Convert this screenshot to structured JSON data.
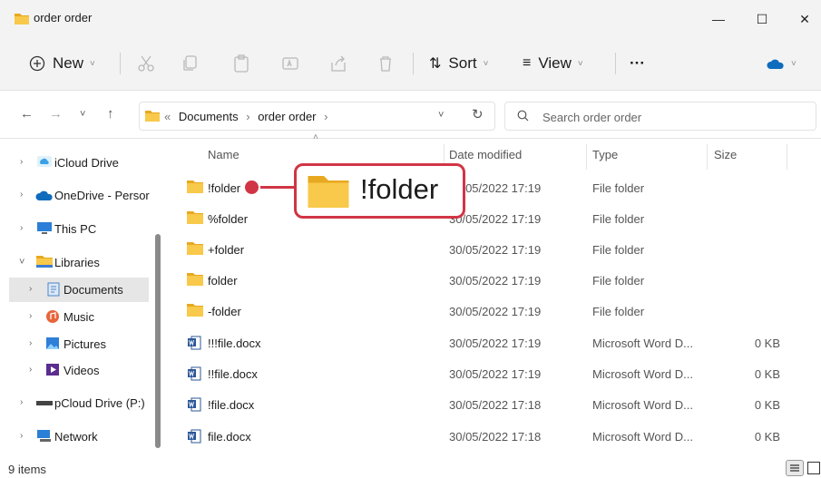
{
  "window": {
    "title": "order order",
    "minimize": "—",
    "maximize": "☐",
    "close": "✕"
  },
  "toolbar": {
    "new_label": "New",
    "sort_label": "Sort",
    "view_label": "View",
    "more_label": "···",
    "colors": {
      "accent": "#0f6cbd",
      "folder": "#f4c542",
      "word": "#2b5797"
    }
  },
  "address": {
    "overflow": "«",
    "crumbs": [
      "Documents",
      "order order"
    ],
    "separator": "›",
    "search_placeholder": "Search order order"
  },
  "sidebar": {
    "items": [
      {
        "label": "iCloud Drive",
        "icon": "icloud-icon"
      },
      {
        "label": "OneDrive - Persor",
        "icon": "onedrive-icon"
      },
      {
        "label": "This PC",
        "icon": "pc-icon"
      },
      {
        "label": "Libraries",
        "icon": "library-folder-icon"
      },
      {
        "label": "Documents",
        "icon": "documents-icon"
      },
      {
        "label": "Music",
        "icon": "music-icon"
      },
      {
        "label": "Pictures",
        "icon": "pictures-icon"
      },
      {
        "label": "Videos",
        "icon": "videos-icon"
      },
      {
        "label": "pCloud Drive (P:)",
        "icon": "drive-icon"
      },
      {
        "label": "Network",
        "icon": "network-icon"
      }
    ]
  },
  "columns": {
    "name": "Name",
    "date": "Date modified",
    "type": "Type",
    "size": "Size"
  },
  "files": [
    {
      "name": "!folder",
      "date": "30/05/2022 17:19",
      "type": "File folder",
      "size": "",
      "kind": "folder"
    },
    {
      "name": "%folder",
      "date": "30/05/2022 17:19",
      "type": "File folder",
      "size": "",
      "kind": "folder"
    },
    {
      "name": "+folder",
      "date": "30/05/2022 17:19",
      "type": "File folder",
      "size": "",
      "kind": "folder"
    },
    {
      "name": "folder",
      "date": "30/05/2022 17:19",
      "type": "File folder",
      "size": "",
      "kind": "folder"
    },
    {
      "name": "-folder",
      "date": "30/05/2022 17:19",
      "type": "File folder",
      "size": "",
      "kind": "folder"
    },
    {
      "name": "!!!file.docx",
      "date": "30/05/2022 17:19",
      "type": "Microsoft Word D...",
      "size": "0 KB",
      "kind": "docx"
    },
    {
      "name": "!!file.docx",
      "date": "30/05/2022 17:19",
      "type": "Microsoft Word D...",
      "size": "0 KB",
      "kind": "docx"
    },
    {
      "name": "!file.docx",
      "date": "30/05/2022 17:18",
      "type": "Microsoft Word D...",
      "size": "0 KB",
      "kind": "docx"
    },
    {
      "name": "file.docx",
      "date": "30/05/2022 17:18",
      "type": "Microsoft Word D...",
      "size": "0 KB",
      "kind": "docx"
    }
  ],
  "callout": {
    "text": "!folder",
    "color": "#d03545"
  },
  "status": {
    "items_count": "9 items"
  }
}
